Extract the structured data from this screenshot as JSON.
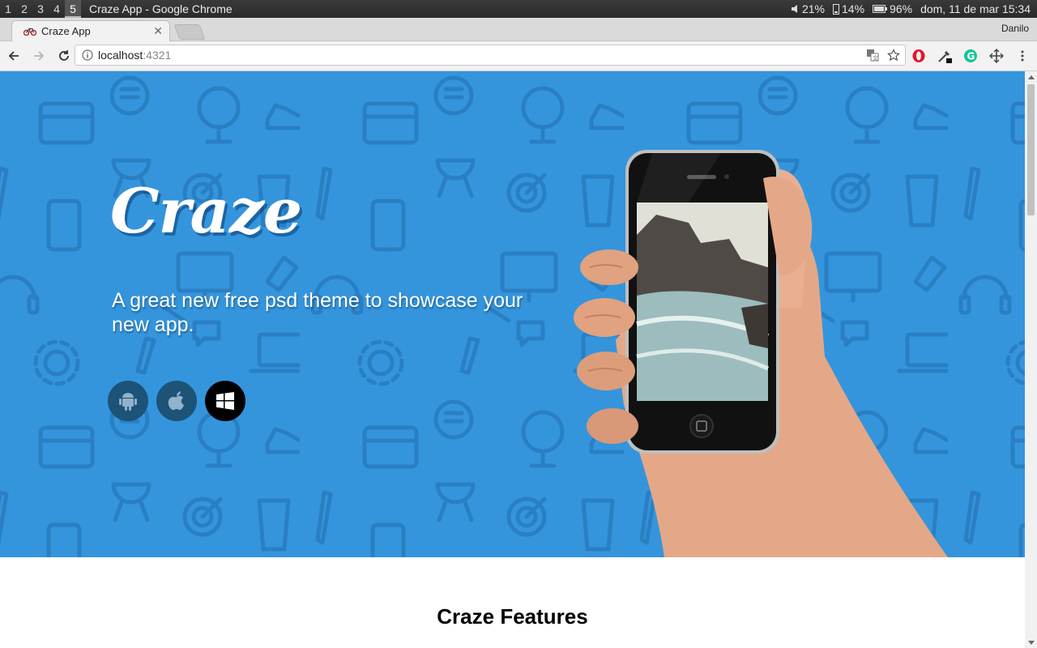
{
  "os": {
    "workspaces": [
      "1",
      "2",
      "3",
      "4",
      "5"
    ],
    "active_workspace": "5",
    "window_title": "Craze App - Google Chrome",
    "volume": "21%",
    "phone_battery": "14%",
    "battery": "96%",
    "datetime": "dom, 11 de mar 15:34"
  },
  "browser": {
    "tab_title": "Craze App",
    "profile_name": "Danilo",
    "url_host": "localhost",
    "url_port": ":4321",
    "extension_colors": {
      "opera": "#e3142c",
      "grammarly": "#15c39a"
    }
  },
  "page": {
    "brand": "Craze",
    "tagline": "A great new free psd theme to showcase your new app.",
    "hero_color": "#3495dd",
    "store_buttons": [
      {
        "icon": "android-icon"
      },
      {
        "icon": "apple-icon"
      },
      {
        "icon": "windows-icon"
      }
    ],
    "features_title": "Craze Features"
  }
}
